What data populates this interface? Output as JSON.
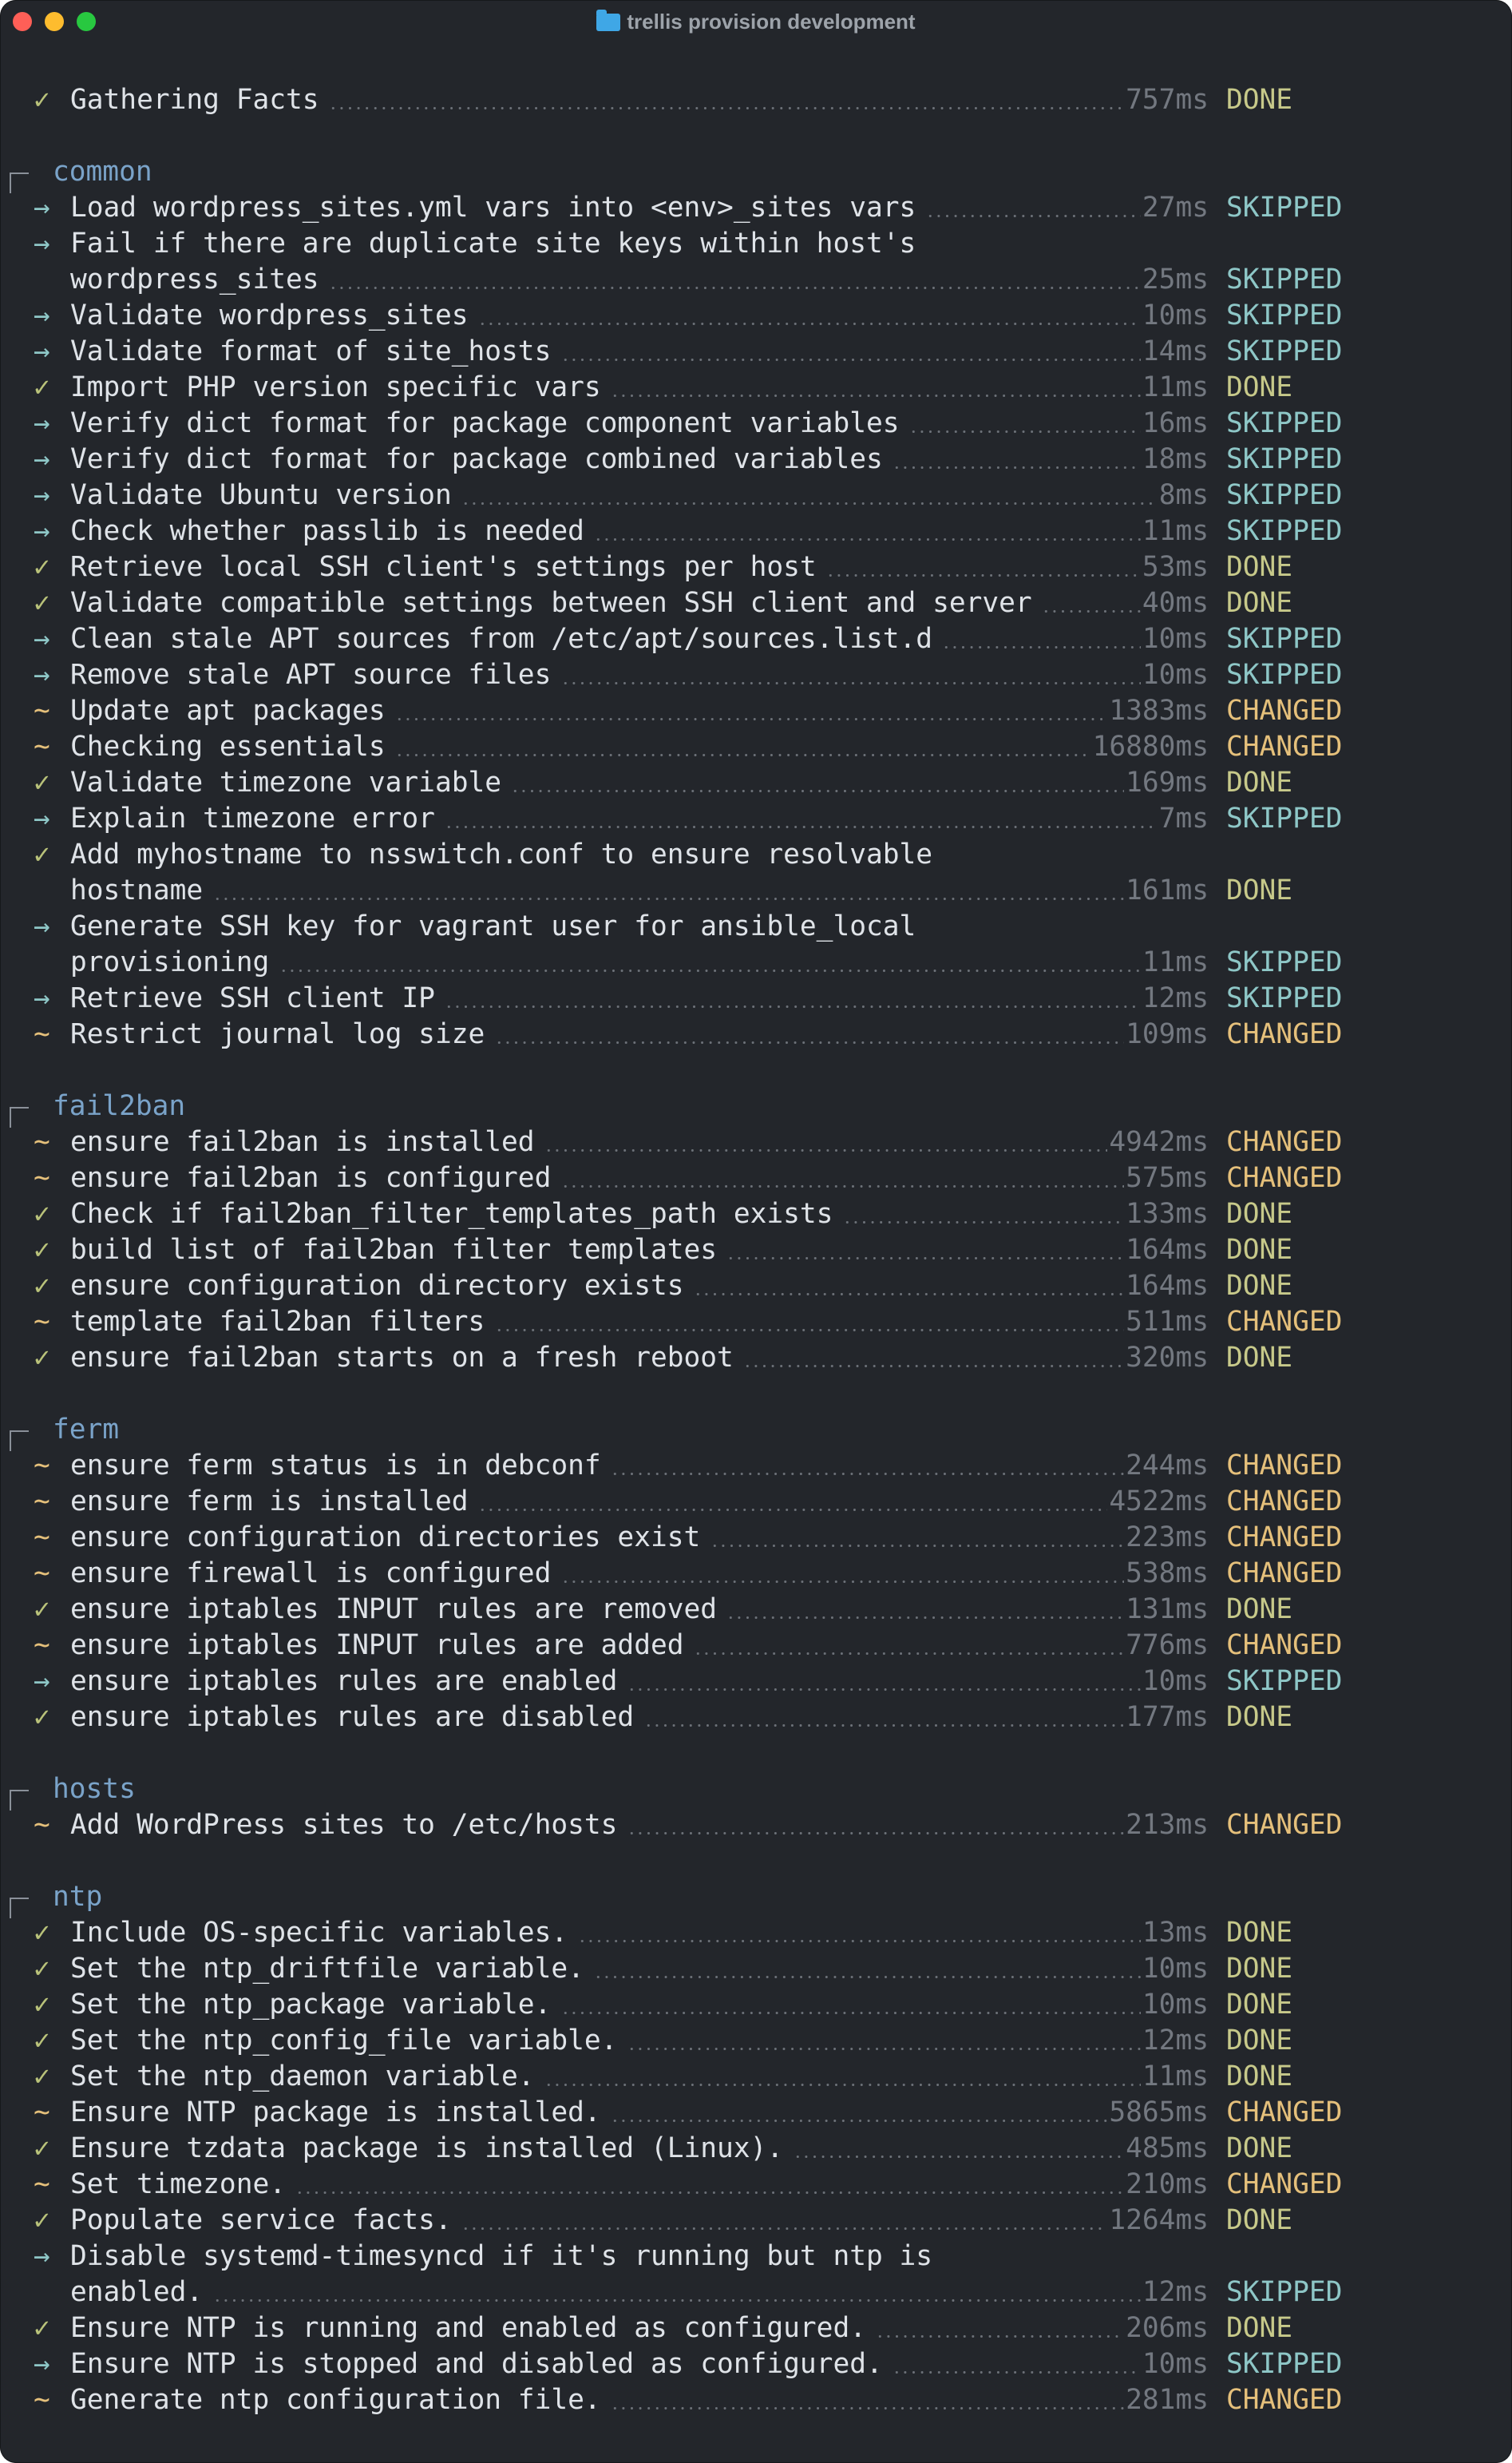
{
  "window": {
    "title": "trellis provision development",
    "folder_icon": "folder-icon",
    "traffic_lights": [
      "close",
      "minimize",
      "zoom"
    ]
  },
  "colors": {
    "background": "#23262b",
    "text": "#dfe3e8",
    "section": "#7aa3c9",
    "done": "#c7c98a",
    "skipped": "#8ec7c7",
    "changed": "#e5c07b",
    "duration": "#737880"
  },
  "markers": {
    "DONE": "✓",
    "SKIPPED": "→",
    "CHANGED": "~"
  },
  "blocks": [
    {
      "title": "",
      "tasks": [
        {
          "lines": [
            "Gathering Facts"
          ],
          "duration": "757ms",
          "status": "DONE"
        }
      ]
    },
    {
      "title": "common",
      "tasks": [
        {
          "lines": [
            "Load wordpress_sites.yml vars into <env>_sites vars"
          ],
          "duration": "27ms",
          "status": "SKIPPED"
        },
        {
          "lines": [
            "Fail if there are duplicate site keys within host's",
            "wordpress_sites"
          ],
          "duration": "25ms",
          "status": "SKIPPED"
        },
        {
          "lines": [
            "Validate wordpress_sites"
          ],
          "duration": "10ms",
          "status": "SKIPPED"
        },
        {
          "lines": [
            "Validate format of site_hosts"
          ],
          "duration": "14ms",
          "status": "SKIPPED"
        },
        {
          "lines": [
            "Import PHP version specific vars"
          ],
          "duration": "11ms",
          "status": "DONE"
        },
        {
          "lines": [
            "Verify dict format for package component variables"
          ],
          "duration": "16ms",
          "status": "SKIPPED"
        },
        {
          "lines": [
            "Verify dict format for package combined variables"
          ],
          "duration": "18ms",
          "status": "SKIPPED"
        },
        {
          "lines": [
            "Validate Ubuntu version"
          ],
          "duration": "8ms",
          "status": "SKIPPED"
        },
        {
          "lines": [
            "Check whether passlib is needed"
          ],
          "duration": "11ms",
          "status": "SKIPPED"
        },
        {
          "lines": [
            "Retrieve local SSH client's settings per host"
          ],
          "duration": "53ms",
          "status": "DONE"
        },
        {
          "lines": [
            "Validate compatible settings between SSH client and server"
          ],
          "duration": "40ms",
          "status": "DONE"
        },
        {
          "lines": [
            "Clean stale APT sources from /etc/apt/sources.list.d"
          ],
          "duration": "10ms",
          "status": "SKIPPED"
        },
        {
          "lines": [
            "Remove stale APT source files"
          ],
          "duration": "10ms",
          "status": "SKIPPED"
        },
        {
          "lines": [
            "Update apt packages"
          ],
          "duration": "1383ms",
          "status": "CHANGED"
        },
        {
          "lines": [
            "Checking essentials"
          ],
          "duration": "16880ms",
          "status": "CHANGED"
        },
        {
          "lines": [
            "Validate timezone variable"
          ],
          "duration": "169ms",
          "status": "DONE"
        },
        {
          "lines": [
            "Explain timezone error"
          ],
          "duration": "7ms",
          "status": "SKIPPED"
        },
        {
          "lines": [
            "Add myhostname to nsswitch.conf to ensure resolvable",
            "hostname"
          ],
          "duration": "161ms",
          "status": "DONE"
        },
        {
          "lines": [
            "Generate SSH key for vagrant user for ansible_local",
            "provisioning"
          ],
          "duration": "11ms",
          "status": "SKIPPED"
        },
        {
          "lines": [
            "Retrieve SSH client IP"
          ],
          "duration": "12ms",
          "status": "SKIPPED"
        },
        {
          "lines": [
            "Restrict journal log size"
          ],
          "duration": "109ms",
          "status": "CHANGED"
        }
      ]
    },
    {
      "title": "fail2ban",
      "tasks": [
        {
          "lines": [
            "ensure fail2ban is installed"
          ],
          "duration": "4942ms",
          "status": "CHANGED"
        },
        {
          "lines": [
            "ensure fail2ban is configured"
          ],
          "duration": "575ms",
          "status": "CHANGED"
        },
        {
          "lines": [
            "Check if fail2ban_filter_templates_path exists"
          ],
          "duration": "133ms",
          "status": "DONE"
        },
        {
          "lines": [
            "build list of fail2ban filter templates"
          ],
          "duration": "164ms",
          "status": "DONE"
        },
        {
          "lines": [
            "ensure configuration directory exists"
          ],
          "duration": "164ms",
          "status": "DONE"
        },
        {
          "lines": [
            "template fail2ban filters"
          ],
          "duration": "511ms",
          "status": "CHANGED"
        },
        {
          "lines": [
            "ensure fail2ban starts on a fresh reboot"
          ],
          "duration": "320ms",
          "status": "DONE"
        }
      ]
    },
    {
      "title": "ferm",
      "tasks": [
        {
          "lines": [
            "ensure ferm status is in debconf"
          ],
          "duration": "244ms",
          "status": "CHANGED"
        },
        {
          "lines": [
            "ensure ferm is installed"
          ],
          "duration": "4522ms",
          "status": "CHANGED"
        },
        {
          "lines": [
            "ensure configuration directories exist"
          ],
          "duration": "223ms",
          "status": "CHANGED"
        },
        {
          "lines": [
            "ensure firewall is configured"
          ],
          "duration": "538ms",
          "status": "CHANGED"
        },
        {
          "lines": [
            "ensure iptables INPUT rules are removed"
          ],
          "duration": "131ms",
          "status": "DONE"
        },
        {
          "lines": [
            "ensure iptables INPUT rules are added"
          ],
          "duration": "776ms",
          "status": "CHANGED"
        },
        {
          "lines": [
            "ensure iptables rules are enabled"
          ],
          "duration": "10ms",
          "status": "SKIPPED"
        },
        {
          "lines": [
            "ensure iptables rules are disabled"
          ],
          "duration": "177ms",
          "status": "DONE"
        }
      ]
    },
    {
      "title": "hosts",
      "tasks": [
        {
          "lines": [
            "Add WordPress sites to /etc/hosts"
          ],
          "duration": "213ms",
          "status": "CHANGED"
        }
      ]
    },
    {
      "title": "ntp",
      "tasks": [
        {
          "lines": [
            "Include OS-specific variables."
          ],
          "duration": "13ms",
          "status": "DONE"
        },
        {
          "lines": [
            "Set the ntp_driftfile variable."
          ],
          "duration": "10ms",
          "status": "DONE"
        },
        {
          "lines": [
            "Set the ntp_package variable."
          ],
          "duration": "10ms",
          "status": "DONE"
        },
        {
          "lines": [
            "Set the ntp_config_file variable."
          ],
          "duration": "12ms",
          "status": "DONE"
        },
        {
          "lines": [
            "Set the ntp_daemon variable."
          ],
          "duration": "11ms",
          "status": "DONE"
        },
        {
          "lines": [
            "Ensure NTP package is installed."
          ],
          "duration": "5865ms",
          "status": "CHANGED"
        },
        {
          "lines": [
            "Ensure tzdata package is installed (Linux)."
          ],
          "duration": "485ms",
          "status": "DONE"
        },
        {
          "lines": [
            "Set timezone."
          ],
          "duration": "210ms",
          "status": "CHANGED"
        },
        {
          "lines": [
            "Populate service facts."
          ],
          "duration": "1264ms",
          "status": "DONE"
        },
        {
          "lines": [
            "Disable systemd-timesyncd if it's running but ntp is",
            "enabled."
          ],
          "duration": "12ms",
          "status": "SKIPPED"
        },
        {
          "lines": [
            "Ensure NTP is running and enabled as configured."
          ],
          "duration": "206ms",
          "status": "DONE"
        },
        {
          "lines": [
            "Ensure NTP is stopped and disabled as configured."
          ],
          "duration": "10ms",
          "status": "SKIPPED"
        },
        {
          "lines": [
            "Generate ntp configuration file."
          ],
          "duration": "281ms",
          "status": "CHANGED"
        }
      ]
    }
  ]
}
